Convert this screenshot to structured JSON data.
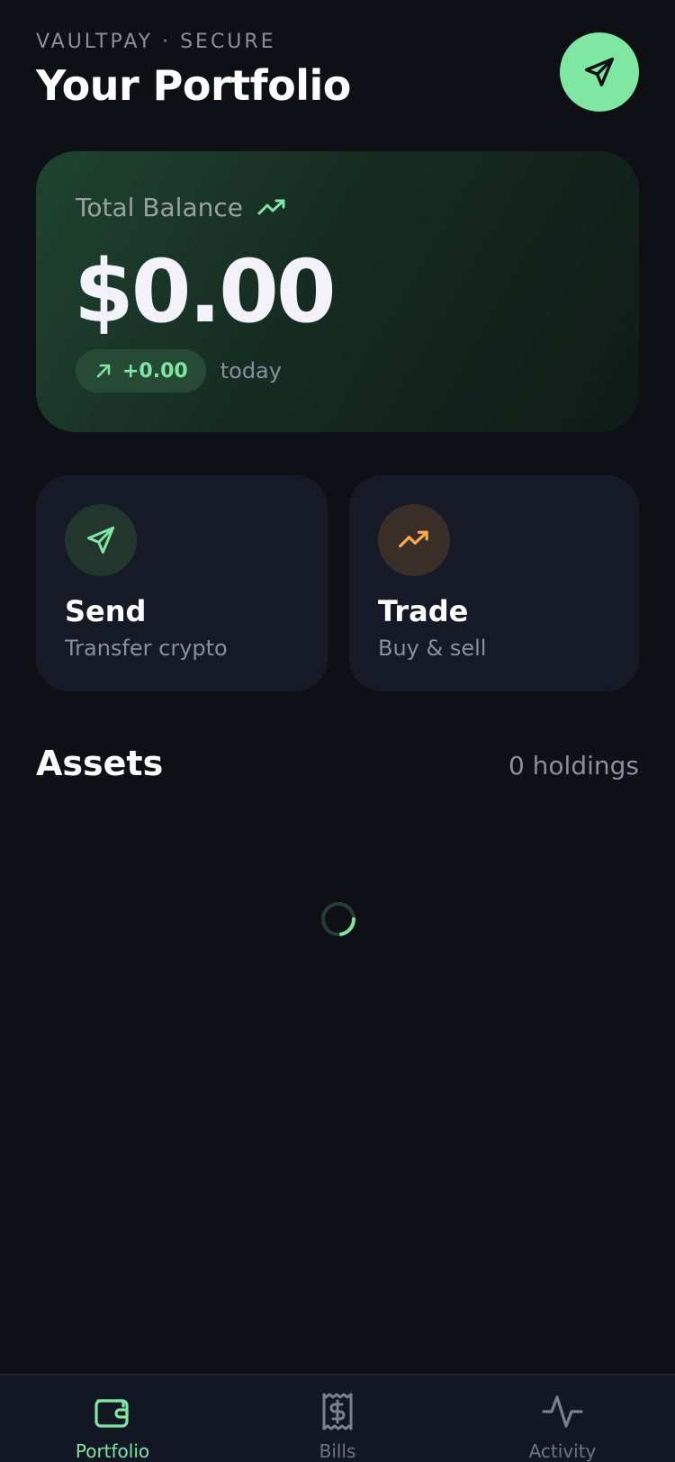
{
  "header": {
    "eyebrow": "VAULTPAY · SECURE",
    "title": "Your Portfolio",
    "send_button_icon": "send-icon"
  },
  "balance": {
    "label": "Total Balance",
    "value": "$0.00",
    "change": "+0.00",
    "period": "today",
    "trend_icon": "trending-up-icon"
  },
  "actions": [
    {
      "title": "Send",
      "subtitle": "Transfer crypto",
      "icon": "send-icon"
    },
    {
      "title": "Trade",
      "subtitle": "Buy & sell",
      "icon": "trending-up-icon"
    }
  ],
  "assets": {
    "title": "Assets",
    "count_label": "0 holdings",
    "loading": true
  },
  "nav": {
    "items": [
      {
        "label": "Portfolio",
        "icon": "wallet-icon",
        "active": true
      },
      {
        "label": "Bills",
        "icon": "receipt-icon",
        "active": false
      },
      {
        "label": "Activity",
        "icon": "activity-icon",
        "active": false
      }
    ]
  },
  "colors": {
    "background": "#0e1016",
    "accent": "#7ee7a2",
    "card": "#161a26",
    "trade_accent": "#f5a94a",
    "muted_text": "#8a8f9e"
  }
}
